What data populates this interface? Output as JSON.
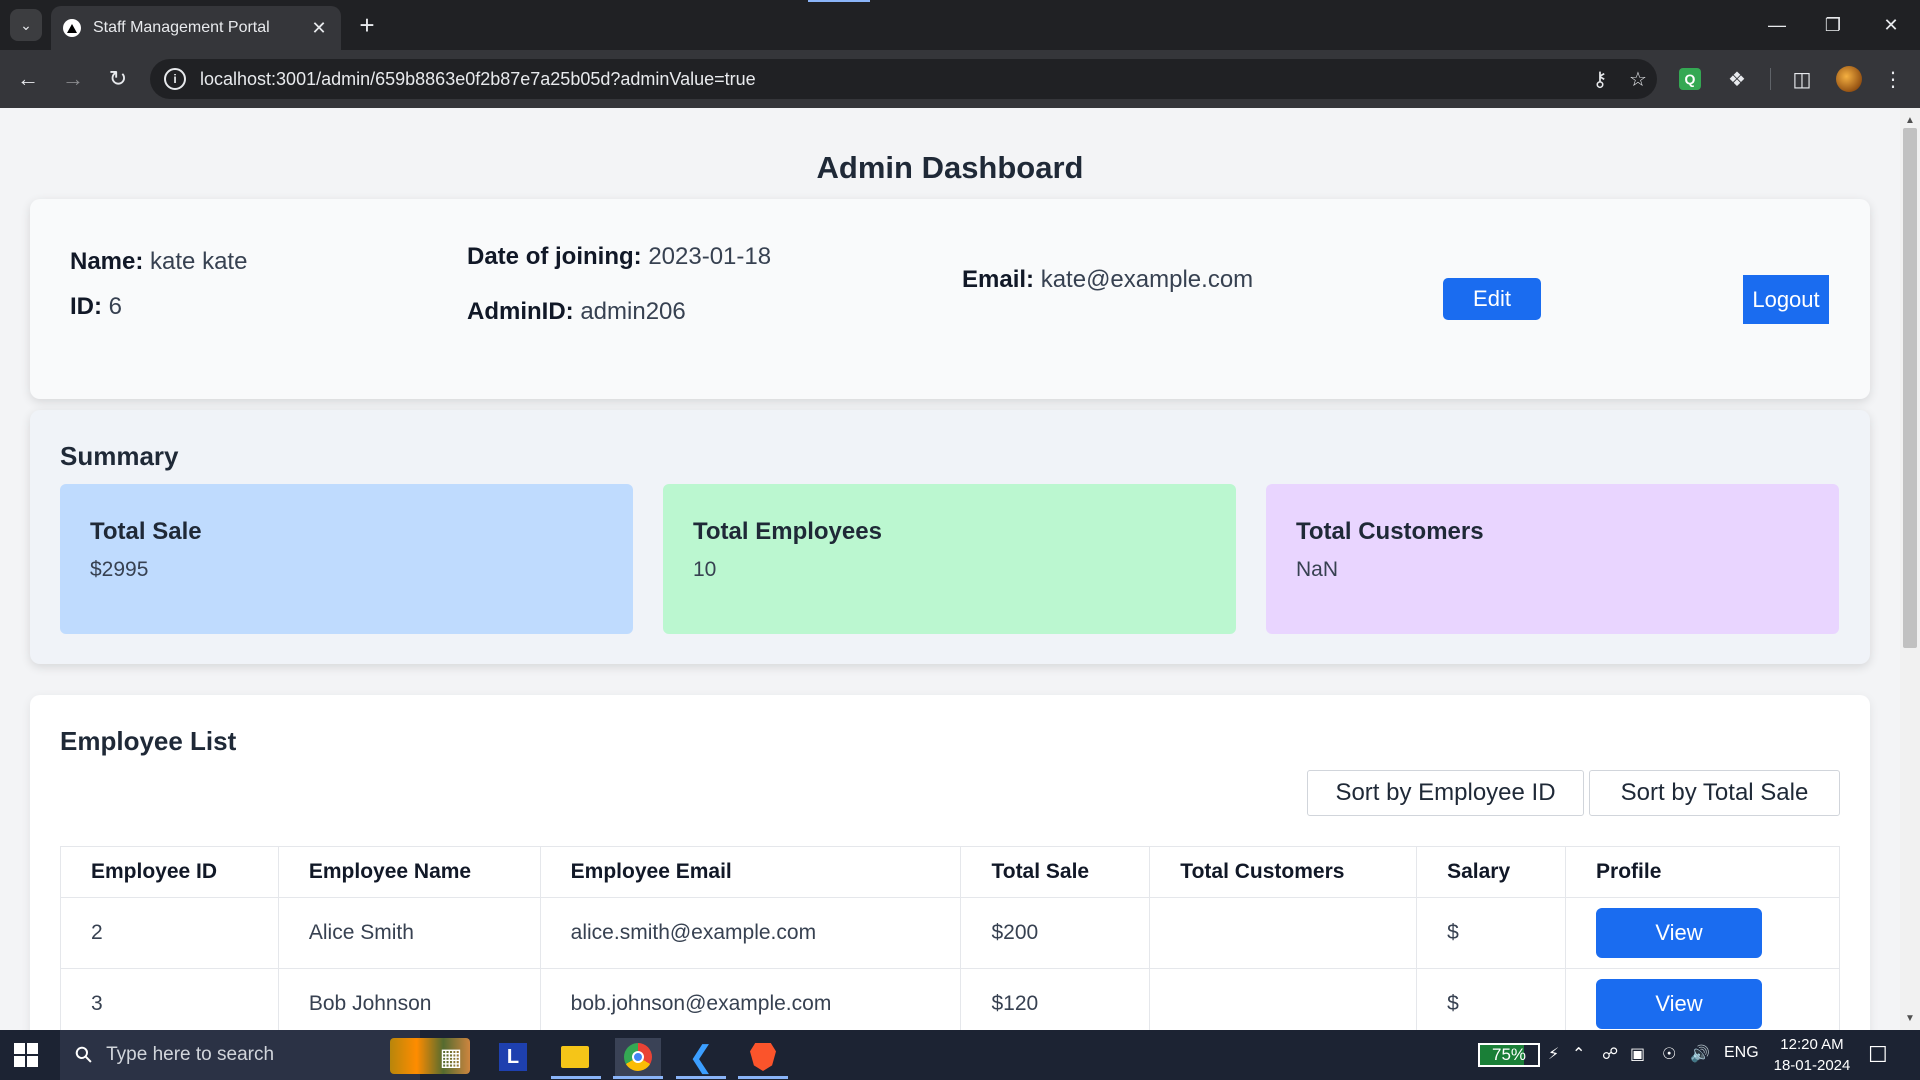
{
  "browser": {
    "tab_title": "Staff Management Portal",
    "url": "localhost:3001/admin/659b8863e0f2b87e7a25b05d?adminValue=true"
  },
  "page": {
    "title": "Admin Dashboard"
  },
  "profile": {
    "name_label": "Name:",
    "name": "kate kate",
    "id_label": "ID:",
    "id": "6",
    "doj_label": "Date of joining:",
    "doj": "2023-01-18",
    "admin_id_label": "AdminID:",
    "admin_id": "admin206",
    "email_label": "Email:",
    "email": "kate@example.com",
    "edit_label": "Edit",
    "logout_label": "Logout"
  },
  "summary": {
    "heading": "Summary",
    "cards": [
      {
        "label": "Total Sale",
        "value": "$2995",
        "color": "#bfdbfe"
      },
      {
        "label": "Total Employees",
        "value": "10",
        "color": "#bbf7d0"
      },
      {
        "label": "Total Customers",
        "value": "NaN",
        "color": "#e9d5ff"
      }
    ]
  },
  "employees": {
    "heading": "Employee List",
    "sort_id_label": "Sort by Employee ID",
    "sort_sale_label": "Sort by Total Sale",
    "columns": [
      "Employee ID",
      "Employee Name",
      "Employee Email",
      "Total Sale",
      "Total Customers",
      "Salary",
      "Profile"
    ],
    "rows": [
      {
        "id": "2",
        "name": "Alice Smith",
        "email": "alice.smith@example.com",
        "sale": "$200",
        "customers": "",
        "salary": "$",
        "action": "View"
      },
      {
        "id": "3",
        "name": "Bob Johnson",
        "email": "bob.johnson@example.com",
        "sale": "$120",
        "customers": "",
        "salary": "$",
        "action": "View"
      }
    ]
  },
  "taskbar": {
    "search_placeholder": "Type here to search",
    "launcher_letter": "L",
    "battery": "75%",
    "battery_level": 0.75,
    "language": "ENG",
    "time": "12:20 AM",
    "date": "18-01-2024"
  },
  "colors": {
    "accent": "#1a6cf0"
  }
}
